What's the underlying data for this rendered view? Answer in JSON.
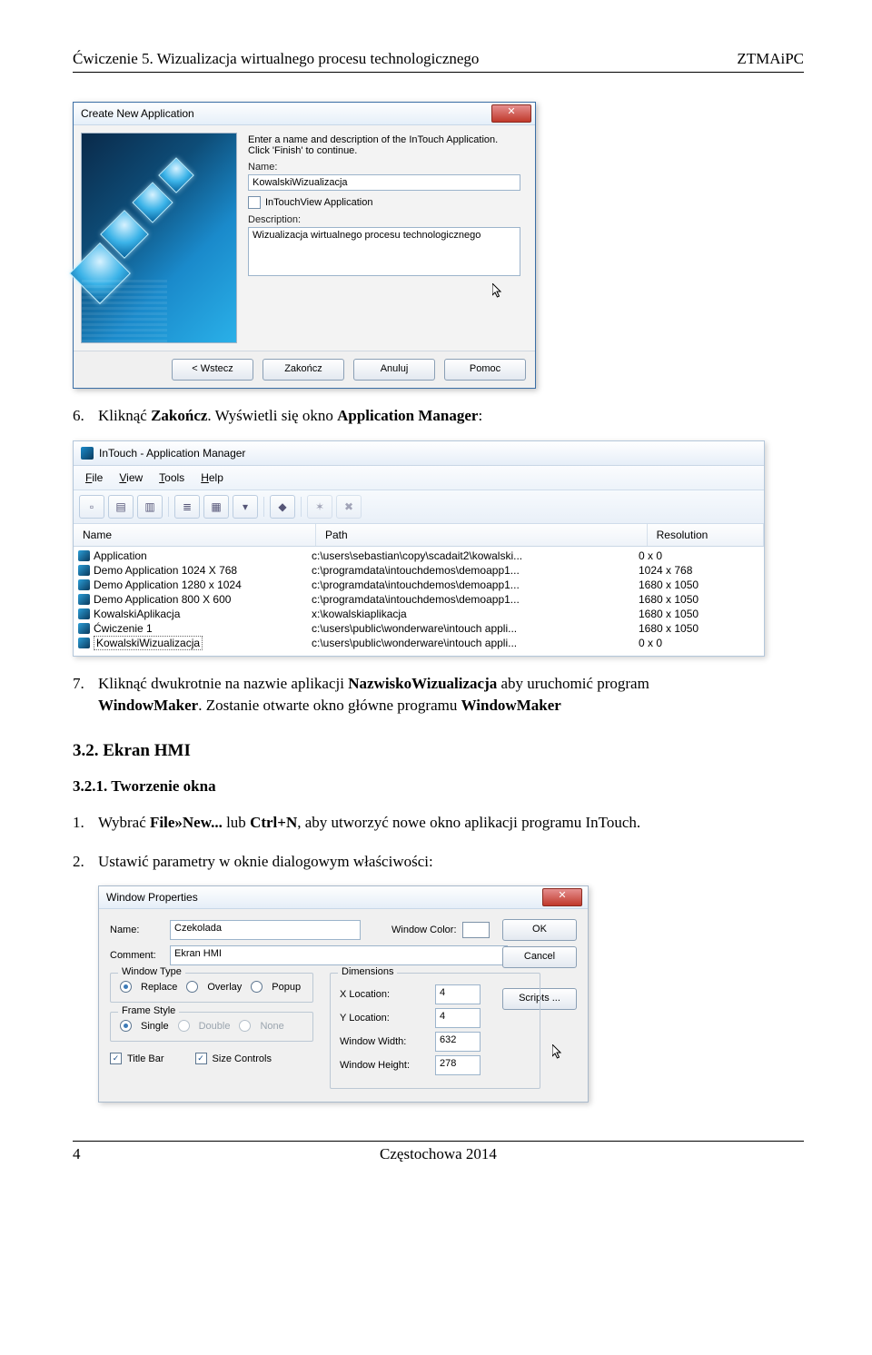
{
  "header": {
    "left": "Ćwiczenie 5. Wizualizacja wirtualnego procesu technologicznego",
    "right": "ZTMAiPC"
  },
  "step6": {
    "num": "6.",
    "pre": "Kliknąć ",
    "bold": "Zakończ",
    "post": ". Wyświetli się okno ",
    "bold2": "Application Manager",
    "tail": ":"
  },
  "wizard": {
    "title": "Create New Application",
    "instruction1": "Enter a name and description of the InTouch Application.",
    "instruction2": "Click 'Finish' to continue.",
    "name_label": "Name:",
    "name_value": "KowalskiWizualizacja",
    "checkbox_label": "InTouchView Application",
    "desc_label": "Description:",
    "desc_value": "Wizualizacja wirtualnego procesu technologicznego",
    "buttons": {
      "back": "< Wstecz",
      "finish": "Zakończ",
      "cancel": "Anuluj",
      "help": "Pomoc"
    }
  },
  "appman": {
    "title": "InTouch - Application Manager",
    "menu": {
      "file": "File",
      "view": "View",
      "tools": "Tools",
      "help": "Help"
    },
    "columns": {
      "name": "Name",
      "path": "Path",
      "res": "Resolution"
    },
    "rows": [
      {
        "name": "Application",
        "path": "c:\\users\\sebastian\\copy\\scadait2\\kowalski...",
        "res": "0 x 0"
      },
      {
        "name": "Demo Application 1024 X 768",
        "path": "c:\\programdata\\intouchdemos\\demoapp1...",
        "res": "1024 x 768"
      },
      {
        "name": "Demo Application 1280 x 1024",
        "path": "c:\\programdata\\intouchdemos\\demoapp1...",
        "res": "1680 x 1050"
      },
      {
        "name": "Demo Application 800 X 600",
        "path": "c:\\programdata\\intouchdemos\\demoapp1...",
        "res": "1680 x 1050"
      },
      {
        "name": "KowalskiAplikacja",
        "path": "x:\\kowalskiaplikacja",
        "res": "1680 x 1050"
      },
      {
        "name": "Ćwiczenie 1",
        "path": "c:\\users\\public\\wonderware\\intouch appli...",
        "res": "1680 x 1050"
      },
      {
        "name": "KowalskiWizualizacja",
        "path": "c:\\users\\public\\wonderware\\intouch appli...",
        "res": "0 x 0"
      }
    ]
  },
  "step7": {
    "num": "7.",
    "pre": "Kliknąć dwukrotnie na nazwie aplikacji ",
    "bold": "NazwiskoWizualizacja",
    "mid": " aby uruchomić program ",
    "bold2": "WindowMaker",
    "post": ". Zostanie otwarte okno główne programu ",
    "bold3": "WindowMaker"
  },
  "section32": "3.2.   Ekran HMI",
  "section321": "3.2.1.    Tworzenie okna",
  "step1b": {
    "num": "1.",
    "pre": "Wybrać ",
    "bold": "File»New...",
    "mid": " lub ",
    "bold2": "Ctrl+N",
    "post": ", aby utworzyć nowe okno aplikacji programu InTouch."
  },
  "step2b": {
    "num": "2.",
    "text": "Ustawić parametry w oknie dialogowym właściwości:"
  },
  "wp": {
    "title": "Window Properties",
    "name_label": "Name:",
    "name_value": "Czekolada",
    "wincolor_label": "Window Color:",
    "comment_label": "Comment:",
    "comment_value": "Ekran HMI",
    "ok": "OK",
    "cancel": "Cancel",
    "scripts": "Scripts ...",
    "wintype_title": "Window Type",
    "wintype": {
      "replace": "Replace",
      "overlay": "Overlay",
      "popup": "Popup"
    },
    "frame_title": "Frame Style",
    "frame": {
      "single": "Single",
      "double": "Double",
      "none": "None"
    },
    "dim_title": "Dimensions",
    "dim": {
      "xloc_label": "X Location:",
      "xloc": "4",
      "yloc_label": "Y Location:",
      "yloc": "4",
      "ww_label": "Window Width:",
      "ww": "632",
      "wh_label": "Window Height:",
      "wh": "278"
    },
    "titlebar": "Title Bar",
    "sizecontrols": "Size Controls"
  },
  "footer": {
    "page": "4",
    "center": "Częstochowa 2014"
  }
}
